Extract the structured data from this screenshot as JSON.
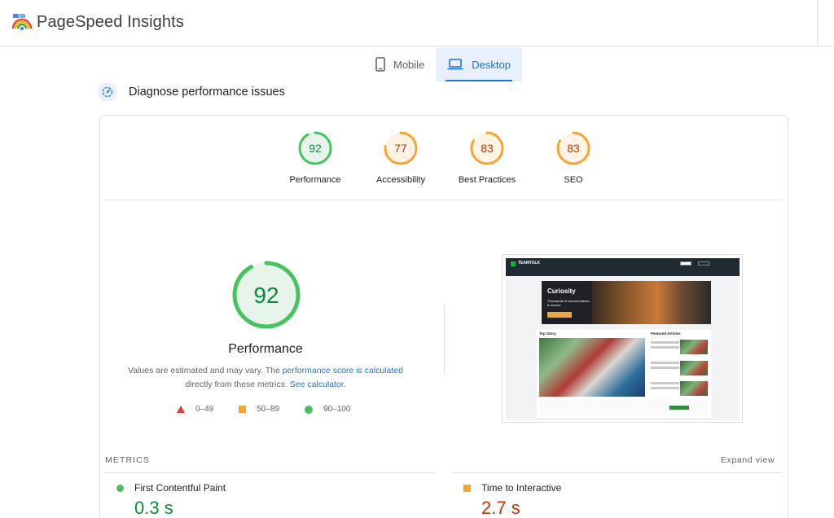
{
  "app": {
    "title": "PageSpeed Insights"
  },
  "tabs": [
    {
      "label": "Mobile",
      "icon": "phone-icon",
      "active": false
    },
    {
      "label": "Desktop",
      "icon": "laptop-icon",
      "active": true
    }
  ],
  "section": {
    "title": "Diagnose performance issues"
  },
  "category_scores": [
    {
      "label": "Performance",
      "score": 92,
      "color": "#0c8a3a"
    },
    {
      "label": "Accessibility",
      "score": 77,
      "color": "#c33300"
    },
    {
      "label": "Best Practices",
      "score": 83,
      "color": "#c33300"
    },
    {
      "label": "SEO",
      "score": 83,
      "color": "#c33300"
    }
  ],
  "performance": {
    "score": 92,
    "title": "Performance",
    "desc_1": "Values are estimated and may vary. The ",
    "desc_link_1": "performance score is calculated",
    "desc_2": "directly from these metrics. ",
    "desc_link_2": "See calculator.",
    "colors": {
      "good": "#45c45e",
      "average": "#f4a534",
      "poor": "#e53935"
    }
  },
  "legend": [
    {
      "shape": "triangle",
      "label": "0–49"
    },
    {
      "shape": "square",
      "label": "50–89"
    },
    {
      "shape": "circle",
      "label": "90–100"
    }
  ],
  "thumbnail": {
    "brand": "TEAMTALK",
    "ad_title": "Curiosity",
    "ad_text": "Thousands of documentaries & movies",
    "top_story": "Top Story",
    "featured": "Featured Articles"
  },
  "metrics": {
    "heading": "METRICS",
    "expand_label": "Expand view",
    "items": [
      {
        "name": "First Contentful Paint",
        "value": "0.3 s",
        "rating": "good"
      },
      {
        "name": "Time to Interactive",
        "value": "2.7 s",
        "rating": "average"
      }
    ]
  }
}
